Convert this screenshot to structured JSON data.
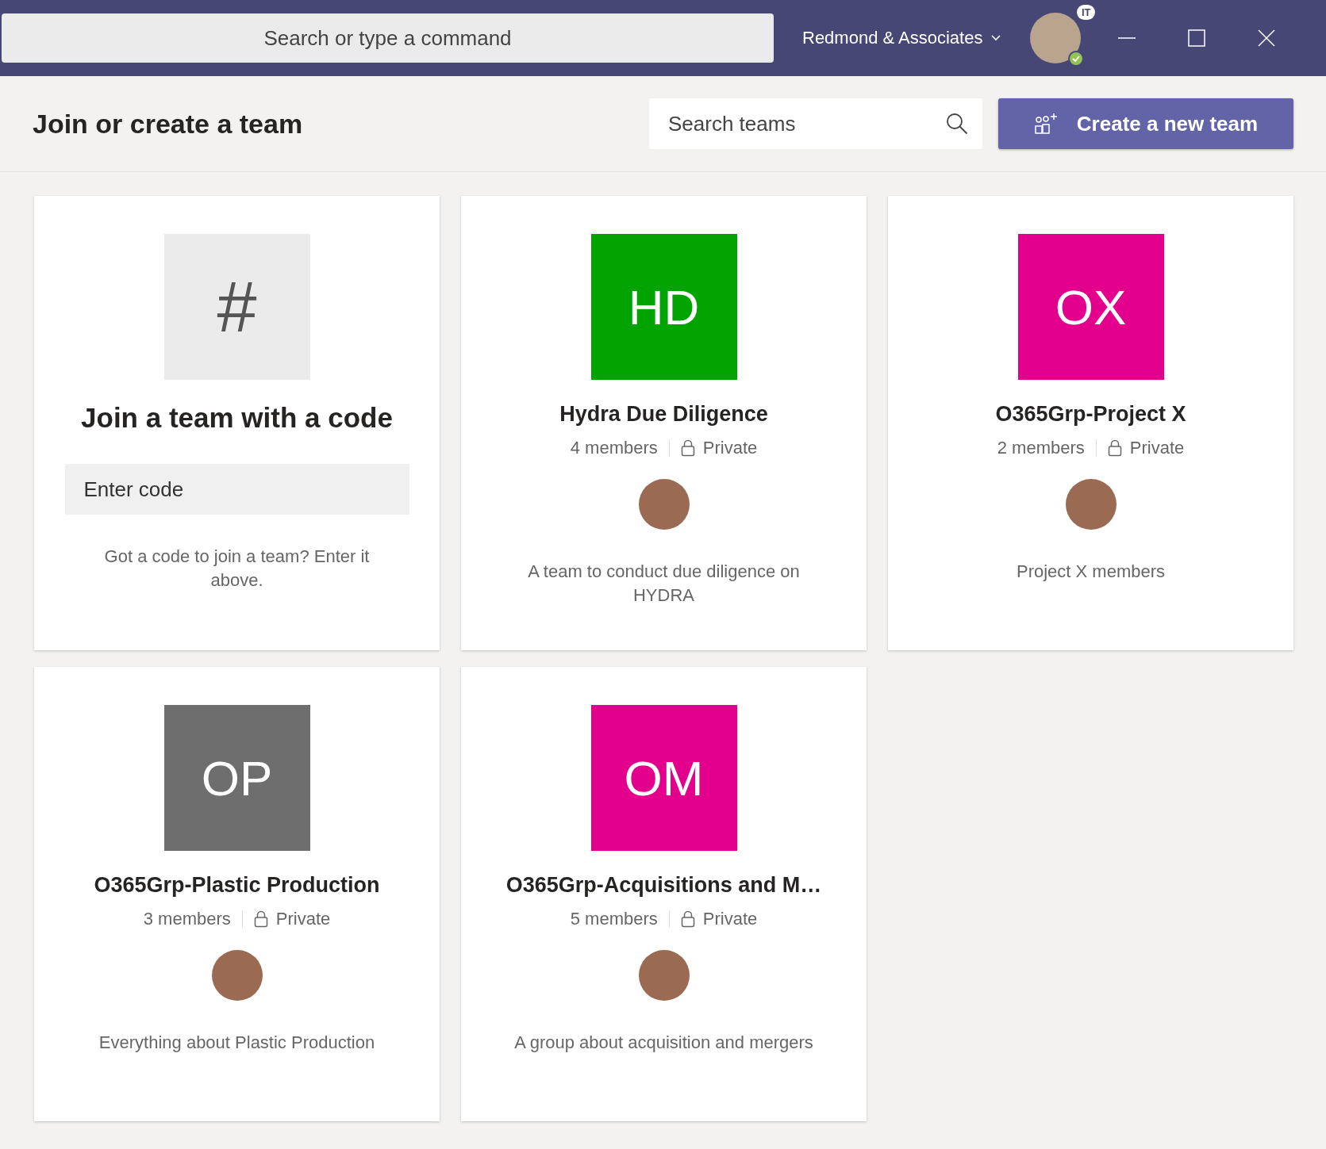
{
  "title_bar": {
    "search": {
      "placeholder": "Search or type a command"
    },
    "org": "Redmond & Associates",
    "avatar_badge": "IT"
  },
  "header": {
    "title": "Join or create a team",
    "search": {
      "placeholder": "Search teams"
    },
    "create_button": "Create a new team"
  },
  "join_card": {
    "glyph": "#",
    "title": "Join a team with a code",
    "code_field": {
      "placeholder": "Enter code"
    },
    "hint": "Got a code to join a team? Enter it above."
  },
  "teams": [
    {
      "initials": "HD",
      "color": "#00a300",
      "name": "Hydra Due Diligence",
      "members": "4 members",
      "privacy": "Private",
      "description": "A team to conduct due diligence on HYDRA"
    },
    {
      "initials": "OX",
      "color": "#e3008c",
      "name": "O365Grp-Project X",
      "members": "2 members",
      "privacy": "Private",
      "description": "Project X members"
    },
    {
      "initials": "OP",
      "color": "#6e6e6e",
      "name": "O365Grp-Plastic Production",
      "members": "3 members",
      "privacy": "Private",
      "description": "Everything about Plastic Production"
    },
    {
      "initials": "OM",
      "color": "#e3008c",
      "name": "O365Grp-Acquisitions and M…",
      "members": "5 members",
      "privacy": "Private",
      "description": "A group about acquisition and mergers"
    }
  ]
}
